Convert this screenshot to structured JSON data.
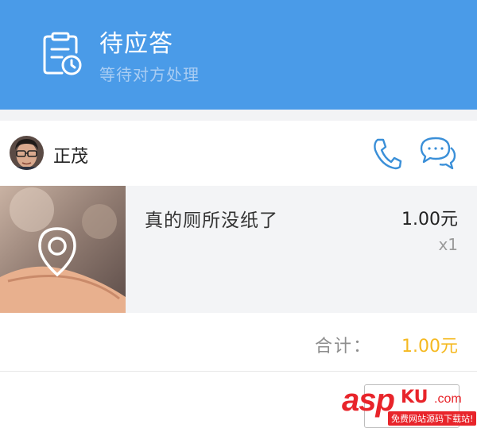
{
  "header": {
    "title": "待应答",
    "subtitle": "等待对方处理",
    "background": "#4a9be8",
    "status_icon": "clipboard-clock-icon"
  },
  "seller": {
    "name": "正茂",
    "avatar_icon": "user-avatar",
    "actions": [
      "phone-icon",
      "chat-bubble-icon"
    ]
  },
  "item": {
    "title": "真的厕所没纸了",
    "price": "1.00元",
    "quantity": "x1",
    "thumbnail_icon": "location-pin-icon"
  },
  "total": {
    "label": "合计：",
    "value": "1.00元",
    "value_color": "#f5b921"
  },
  "watermark": {
    "brand": "asp",
    "brand2": "KU",
    "suffix": ".com",
    "tagline": "免费网站源码下载站!"
  },
  "colors": {
    "accent": "#4a9be8",
    "icon_blue": "#3a8fd8",
    "price_gold": "#f5b921"
  }
}
